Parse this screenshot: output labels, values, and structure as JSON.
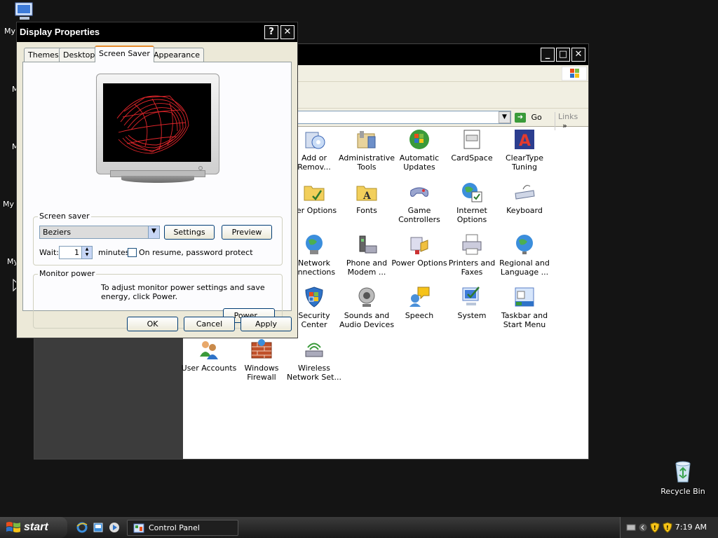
{
  "desktop": {
    "my_computer_partial": "My",
    "partial_labels": [
      "M",
      "M",
      "My I",
      "My"
    ],
    "recycle_bin": "Recycle Bin"
  },
  "control_panel": {
    "address_go": "Go",
    "links": "Links",
    "items": [
      {
        "label": "Add or\nRemov...",
        "icon": "add-remove-programs-icon"
      },
      {
        "label": "Administrative\nTools",
        "icon": "admin-tools-icon"
      },
      {
        "label": "Automatic\nUpdates",
        "icon": "windows-update-icon"
      },
      {
        "label": "CardSpace",
        "icon": "cardspace-icon"
      },
      {
        "label": "ClearType\nTuning",
        "icon": "cleartype-icon"
      },
      {
        "label": "der Options",
        "icon": "folder-options-icon"
      },
      {
        "label": "Fonts",
        "icon": "fonts-icon"
      },
      {
        "label": "Game\nControllers",
        "icon": "game-controller-icon"
      },
      {
        "label": "Internet\nOptions",
        "icon": "internet-options-icon"
      },
      {
        "label": "Keyboard",
        "icon": "keyboard-icon"
      },
      {
        "label": "Network\nonnections",
        "icon": "network-connections-icon"
      },
      {
        "label": "Phone and\nModem ...",
        "icon": "phone-modem-icon"
      },
      {
        "label": "Power Options",
        "icon": "power-options-icon"
      },
      {
        "label": "Printers and\nFaxes",
        "icon": "printer-icon"
      },
      {
        "label": "Regional and\nLanguage ...",
        "icon": "regional-globe-icon"
      },
      {
        "label": "Security\nCenter",
        "icon": "security-shield-icon"
      },
      {
        "label": "Sounds and\nAudio Devices",
        "icon": "speaker-icon"
      },
      {
        "label": "Speech",
        "icon": "speech-icon"
      },
      {
        "label": "System",
        "icon": "system-icon"
      },
      {
        "label": "Taskbar and\nStart Menu",
        "icon": "taskbar-icon"
      },
      {
        "label": "User Accounts",
        "icon": "user-accounts-icon"
      },
      {
        "label": "Windows\nFirewall",
        "icon": "firewall-icon"
      },
      {
        "label": "Wireless\nNetwork Set...",
        "icon": "wireless-icon"
      }
    ]
  },
  "dialog": {
    "title": "Display Properties",
    "tabs": [
      "Themes",
      "Desktop",
      "Screen Saver",
      "Appearance"
    ],
    "active_tab": "Screen Saver",
    "screen_saver_group": "Screen saver",
    "screen_saver_value": "Beziers",
    "settings_btn": "Settings",
    "preview_btn": "Preview",
    "wait_label": "Wait:",
    "wait_value": "1",
    "minutes_label": "minutes",
    "resume_label": "On resume, password protect",
    "monitor_power_group": "Monitor power",
    "monitor_power_text": "To adjust monitor power settings and save energy, click Power.",
    "power_btn": "Power...",
    "ok_btn": "OK",
    "cancel_btn": "Cancel",
    "apply_btn": "Apply"
  },
  "taskbar": {
    "start_label": "start",
    "task_label": "Control Panel",
    "clock": "7:19 AM"
  }
}
